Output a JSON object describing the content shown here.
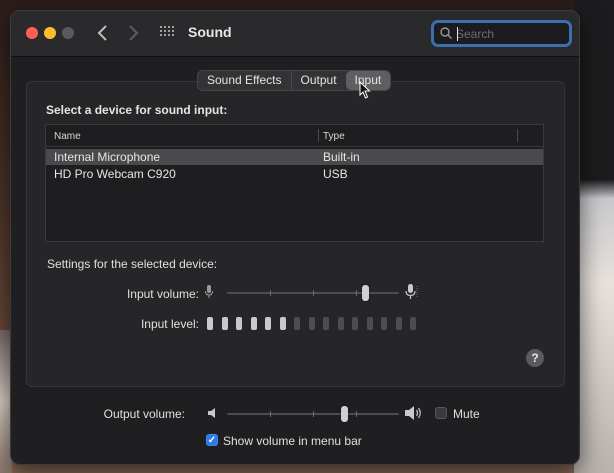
{
  "window": {
    "title": "Sound"
  },
  "toolbar": {
    "back_icon": "chevron-left-icon",
    "forward_icon": "chevron-right-icon",
    "grid_icon": "grid-icon"
  },
  "search": {
    "placeholder": "Search",
    "value": ""
  },
  "tabs": [
    {
      "label": "Sound Effects",
      "active": false
    },
    {
      "label": "Output",
      "active": false
    },
    {
      "label": "Input",
      "active": true
    }
  ],
  "input_section": {
    "heading": "Select a device for sound input:",
    "columns": [
      "Name",
      "Type"
    ],
    "devices": [
      {
        "name": "Internal Microphone",
        "type": "Built-in",
        "selected": true
      },
      {
        "name": "HD Pro Webcam C920",
        "type": "USB",
        "selected": false
      }
    ]
  },
  "settings": {
    "heading": "Settings for the selected device:",
    "input_volume_label": "Input volume:",
    "input_volume_fraction": 0.8,
    "input_level_label": "Input level:",
    "input_level_segments_total": 15,
    "input_level_segments_lit": 6
  },
  "help": {
    "label": "?"
  },
  "output": {
    "output_volume_label": "Output volume:",
    "output_volume_fraction": 0.68,
    "mute_label": "Mute",
    "mute_checked": false,
    "show_in_menubar_label": "Show volume in menu bar",
    "show_in_menubar_checked": true
  },
  "colors": {
    "accent": "#2f7be5",
    "close": "#ff5f57",
    "minimize": "#febc2e",
    "zoom": "#5a5a5c",
    "level_lit": "#c9c9cc",
    "level_dim": "#4d4d50"
  }
}
